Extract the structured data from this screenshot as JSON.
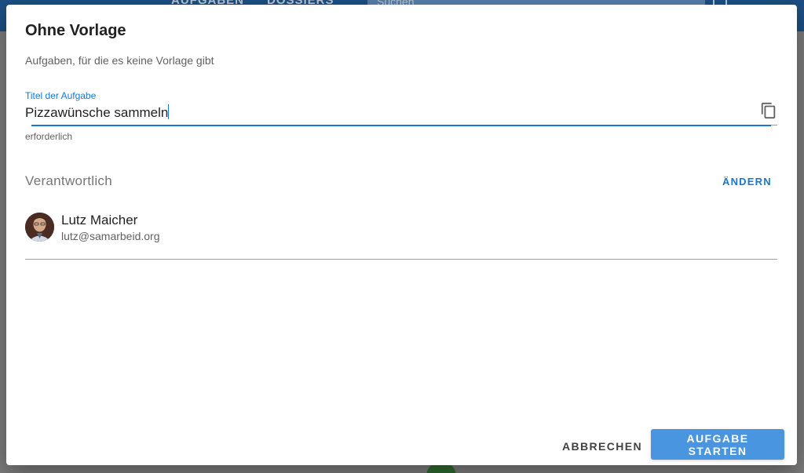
{
  "background": {
    "tabs": [
      "AUFGABEN",
      "DOSSIERS"
    ],
    "search_placeholder": "Suchen"
  },
  "dialog": {
    "title": "Ohne Vorlage",
    "subtitle": "Aufgaben, für die es keine Vorlage gibt",
    "task_field": {
      "label": "Titel der Aufgabe",
      "value": "Pizzawünsche sammeln",
      "helper": "erforderlich"
    },
    "responsible": {
      "label": "Verantwortlich",
      "change_label": "ÄNDERN",
      "person": {
        "name": "Lutz Maicher",
        "email": "lutz@samarbeid.org"
      }
    },
    "actions": {
      "cancel_label": "ABBRECHEN",
      "start_label": "AUFGABE STARTEN"
    }
  },
  "colors": {
    "primary": "#1976d2",
    "button_primary": "#4a95e0",
    "appbar": "#1d4f84"
  },
  "icons": {
    "copy": "copy-icon"
  }
}
